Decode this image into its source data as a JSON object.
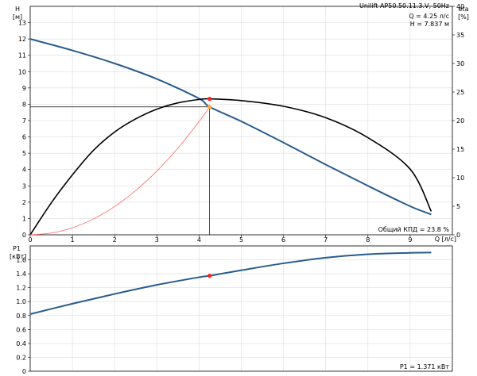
{
  "chart_data": [
    {
      "type": "line",
      "title": "Unilift AP50.50.11.3.V, 50Hz",
      "duty_point": {
        "q_text": "Q = 4.25 л/с",
        "h_text": "H = 7.837 м",
        "q": 4.25,
        "h": 7.837,
        "eta": 23.8
      },
      "efficiency_text": "Общий КПД = 23.8 %",
      "y_label_top": "H",
      "y_unit_top": "[м]",
      "y2_label_top": "eta",
      "y2_unit_top": "[%]",
      "x_label": "Q [л/с]",
      "xlim": [
        0,
        10
      ],
      "ylim": [
        0,
        14
      ],
      "y2lim": [
        0,
        40
      ],
      "x_ticks": [
        0,
        1,
        2,
        3,
        4,
        5,
        6,
        7,
        8,
        9
      ],
      "y_ticks": [
        0,
        1,
        2,
        3,
        4,
        5,
        6,
        7,
        8,
        9,
        10,
        11,
        12,
        13
      ],
      "y2_ticks": [
        0,
        5,
        10,
        15,
        20,
        25,
        30,
        35,
        40
      ],
      "series": [
        {
          "name": "",
          "role": "head",
          "color": "#2a5b8c",
          "x": [
            0,
            1,
            2,
            3,
            4,
            4.25,
            5,
            6,
            7,
            8,
            9,
            9.5
          ],
          "y": [
            12.0,
            11.3,
            10.5,
            9.55,
            8.35,
            7.84,
            6.95,
            5.65,
            4.3,
            3.0,
            1.75,
            1.25
          ]
        },
        {
          "name": "",
          "role": "efficiency",
          "axis": "y2",
          "color": "#000000",
          "x": [
            0,
            0.5,
            1,
            1.5,
            2,
            2.5,
            3,
            3.5,
            4,
            4.25,
            5,
            6,
            7,
            8,
            9,
            9.5
          ],
          "y": [
            0,
            5.6,
            10.5,
            14.8,
            18.0,
            20.3,
            22.0,
            23.1,
            23.7,
            23.8,
            23.5,
            22.5,
            20.5,
            17.0,
            11.5,
            4.1
          ]
        },
        {
          "name": "",
          "role": "system-curve",
          "color": "#ff6666",
          "x": [
            0,
            0.5,
            1,
            1.5,
            2,
            2.5,
            3,
            3.5,
            4,
            4.25
          ],
          "y": [
            0,
            0.108,
            0.434,
            0.976,
            1.736,
            2.712,
            3.905,
            5.316,
            6.943,
            7.837
          ]
        }
      ]
    },
    {
      "type": "line",
      "y_label_top": "P1",
      "y_unit_top": "[кВт]",
      "power_text": "P1 = 1.371 кВт",
      "duty_point": {
        "q": 4.25,
        "p": 1.371
      },
      "xlim": [
        0,
        10
      ],
      "ylim": [
        0,
        1.8
      ],
      "y_ticks": [
        0,
        0.2,
        0.4,
        0.6,
        0.8,
        1.0,
        1.2,
        1.4,
        1.6
      ],
      "y_tick_labels": [
        "0",
        "0.2",
        "0.4",
        "0.6",
        "0.8",
        "1.0",
        "1.2",
        "1.4",
        "1.6"
      ],
      "series": [
        {
          "name": "",
          "role": "power",
          "color": "#2a5b8c",
          "x": [
            0,
            1,
            2,
            3,
            4,
            4.25,
            5,
            6,
            7,
            8,
            9,
            9.5
          ],
          "y": [
            0.82,
            0.97,
            1.11,
            1.24,
            1.35,
            1.371,
            1.45,
            1.55,
            1.63,
            1.68,
            1.7,
            1.705
          ]
        }
      ]
    }
  ],
  "colors": {
    "duty_marker": "#ff2020",
    "duty_marker_head": "#ffaa33",
    "grid": "#dddddd",
    "frame": "#000000"
  }
}
